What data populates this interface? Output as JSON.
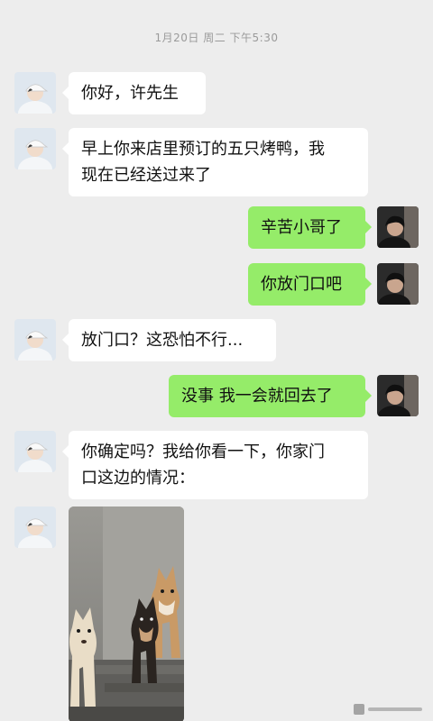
{
  "timestamp": "1月20日 周二 下午5:30",
  "messages": [
    {
      "side": "in",
      "lines": [
        "你好，许先生"
      ]
    },
    {
      "side": "in",
      "lines": [
        "早上你来店里预订的五只烤鸭，我",
        "现在已经送过来了"
      ]
    },
    {
      "side": "out",
      "lines": [
        "辛苦小哥了"
      ]
    },
    {
      "side": "out",
      "lines": [
        "你放门口吧"
      ]
    },
    {
      "side": "in",
      "lines": [
        "放门口？这恐怕不行..."
      ]
    },
    {
      "side": "out",
      "lines": [
        "没事 我一会就回去了"
      ]
    },
    {
      "side": "in",
      "lines": [
        "你确定吗？我给你看一下，你家门",
        "口这边的情况："
      ]
    },
    {
      "side": "in",
      "type": "photo",
      "image": "photo-of-three-shiba-inu-dogs"
    }
  ],
  "avatars": {
    "courier": "avatar-boy-white-cap-icon",
    "user": "avatar-dark-hair-person-icon"
  },
  "colors": {
    "background": "#ededed",
    "incoming_bubble": "#ffffff",
    "outgoing_bubble": "#95ec69",
    "timestamp_text": "#9a9a9a"
  }
}
